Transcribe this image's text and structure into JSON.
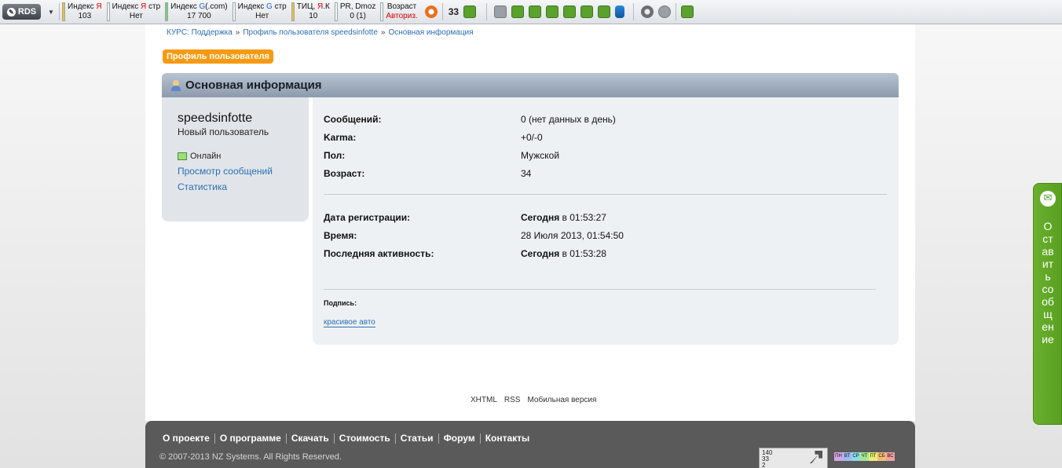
{
  "toolbar": {
    "logo_label": "RDS",
    "metrics": [
      {
        "label_pre": "Индекс ",
        "label_accent": "Я",
        "label_post": "",
        "value": "103",
        "accent": "ya",
        "bar": "yellow",
        "value_red": false
      },
      {
        "label_pre": "Индекс ",
        "label_accent": "Я",
        "label_post": " стр",
        "value": "Нет",
        "accent": "ya",
        "bar": "empty",
        "value_red": false
      },
      {
        "label_pre": "Индекс ",
        "label_accent": "G",
        "label_post": "(.com)",
        "value": "17 700",
        "accent": "g",
        "bar": "green",
        "value_red": false
      },
      {
        "label_pre": "Индекс ",
        "label_accent": "G",
        "label_post": " стр",
        "value": "Нет",
        "accent": "g",
        "bar": "empty",
        "value_red": false
      },
      {
        "label_pre": "ТИЦ, ",
        "label_accent": "Я",
        "label_post": ".К",
        "value": "10",
        "accent": "ya",
        "bar": "yellow",
        "value_red": false
      },
      {
        "label_pre": "PR, Dmoz",
        "label_accent": "",
        "label_post": "",
        "value": "0 (1)",
        "accent": "",
        "bar": "empty",
        "value_red": false
      },
      {
        "label_pre": "Возраст",
        "label_accent": "",
        "label_post": "",
        "value": "Авториз.",
        "accent": "",
        "bar": "empty",
        "value_red": true
      }
    ],
    "count": "33",
    "icons": [
      "info-icon",
      "chart-icon",
      "rss-icon",
      "page-icon",
      "sitemap-icon",
      "robots-icon",
      "edit-icon",
      "home-icon",
      "code-icon",
      "database-icon",
      "gear-icon",
      "recycle-icon",
      "puzzle-icon"
    ]
  },
  "breadcrumb": {
    "items": [
      "КУРС: Поддержка",
      "Профиль пользователя speedsinfotte",
      "Основная информация"
    ],
    "separator": "»"
  },
  "profile_button": "Профиль пользователя",
  "section_title": "Основная информация",
  "sidebar": {
    "username": "speedsinfotte",
    "rank": "Новый пользователь",
    "status": "Онлайн",
    "link_posts": "Просмотр сообщений",
    "link_stats": "Статистика"
  },
  "info": {
    "rows": [
      {
        "label": "Сообщений:",
        "value": "0 (нет данных в день)"
      },
      {
        "label": "Karma:",
        "value": "+0/-0"
      },
      {
        "label": "Пол:",
        "value": "Мужской"
      },
      {
        "label": "Возраст:",
        "value": "34"
      }
    ],
    "rows2": [
      {
        "label": "Дата регистрации:",
        "value_bold": "Сегодня",
        "value_rest": " в 01:53:27"
      },
      {
        "label": "Время:",
        "value_bold": "",
        "value_rest": "28 Июля 2013, 01:54:50"
      },
      {
        "label": "Последняя активность:",
        "value_bold": "Сегодня",
        "value_rest": " в 01:53:28"
      }
    ],
    "signature_label": "Подпись:",
    "signature_link": "красивое авто"
  },
  "footer_links": [
    "XHTML",
    "RSS",
    "Мобильная версия"
  ],
  "footer": {
    "nav": [
      "О проекте",
      "О программе",
      "Скачать",
      "Стоимость",
      "Статьи",
      "Форум",
      "Контакты"
    ],
    "copyright": "© 2007-2013 NZ Systems. All Rights Reserved.",
    "counter_text": "140\n33\n2",
    "days": [
      "ПН",
      "ВТ",
      "СР",
      "ЧТ",
      "ПТ",
      "СБ",
      "ВС"
    ]
  },
  "feedback": {
    "label": "Оставить сообщение"
  },
  "colors": {
    "accent_orange": "#f79a12",
    "link_blue": "#2b6fb6",
    "feedback_green": "#5aa020"
  }
}
